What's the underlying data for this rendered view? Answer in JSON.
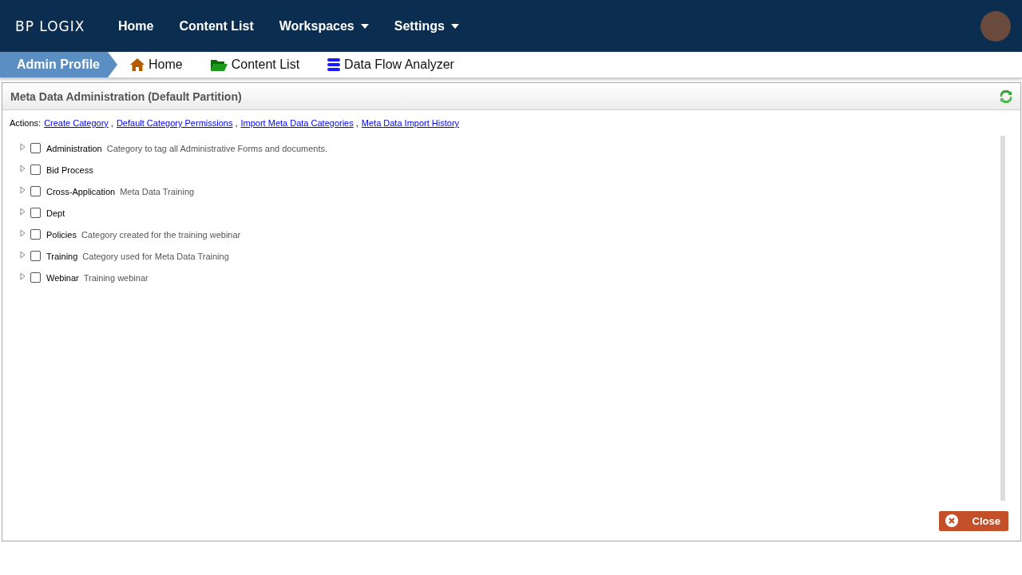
{
  "header": {
    "logo": "BP LOGIX",
    "nav": [
      {
        "label": "Home",
        "dropdown": false
      },
      {
        "label": "Content List",
        "dropdown": false
      },
      {
        "label": "Workspaces",
        "dropdown": true
      },
      {
        "label": "Settings",
        "dropdown": true
      }
    ]
  },
  "breadcrumb": {
    "profile": "Admin Profile",
    "links": [
      {
        "kind": "home",
        "label": "Home"
      },
      {
        "kind": "folder",
        "label": "Content List"
      },
      {
        "kind": "database",
        "label": "Data Flow Analyzer"
      }
    ]
  },
  "panel": {
    "title": "Meta Data Administration (Default Partition)",
    "actions_label": "Actions:",
    "actions": [
      {
        "label": "Create Category",
        "separator": ","
      },
      {
        "label": "Default Category Permissions",
        "separator": ","
      },
      {
        "label": "Import Meta Data Categories",
        "separator": ","
      },
      {
        "label": "Meta Data Import History"
      }
    ],
    "categories": [
      {
        "name": "Administration",
        "description": "Category to tag all Administrative Forms and documents.",
        "checked": false,
        "expanded": false
      },
      {
        "name": "Bid Process",
        "checked": false,
        "expanded": false
      },
      {
        "name": "Cross-Application",
        "description": "Meta Data Training",
        "checked": false,
        "expanded": false
      },
      {
        "name": "Dept",
        "checked": false,
        "expanded": false
      },
      {
        "name": "Policies",
        "description": "Category created for the training webinar",
        "checked": false,
        "expanded": false
      },
      {
        "name": "Training",
        "description": "Category used for Meta Data Training",
        "checked": false,
        "expanded": false
      },
      {
        "name": "Webinar",
        "description": "Training webinar",
        "checked": false,
        "expanded": false
      }
    ],
    "close": "Close"
  }
}
